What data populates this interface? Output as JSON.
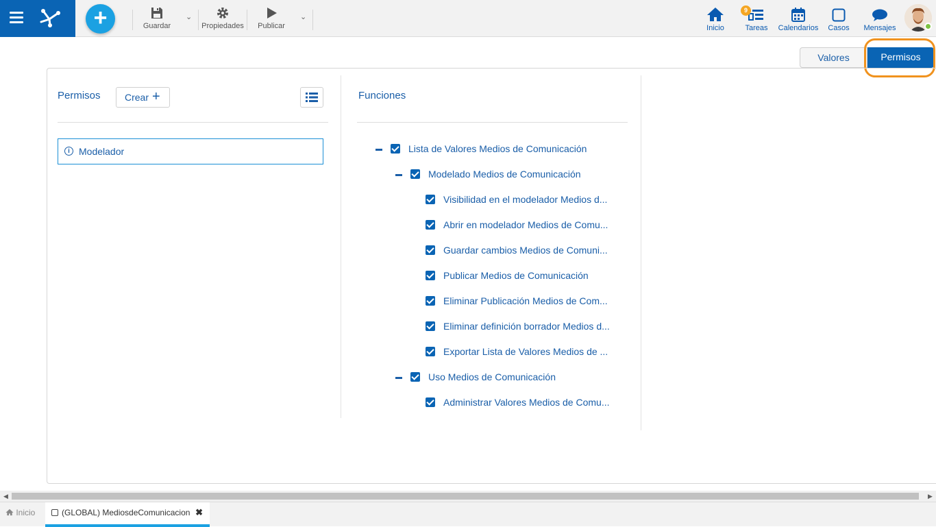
{
  "toolbar": {
    "guardar": "Guardar",
    "propiedades": "Propiedades",
    "publicar": "Publicar"
  },
  "nav": {
    "inicio": "Inicio",
    "tareas": "Tareas",
    "tareas_badge": "9",
    "calendarios": "Calendarios",
    "casos": "Casos",
    "mensajes": "Mensajes"
  },
  "mode_tabs": {
    "valores": "Valores",
    "permisos": "Permisos"
  },
  "permisos_panel": {
    "title": "Permisos",
    "crear_label": "Crear",
    "items": [
      "Modelador"
    ]
  },
  "funciones_panel": {
    "title": "Funciones",
    "tree": [
      "Lista de Valores Medios de Comunicación",
      "Modelado Medios de Comunicación",
      "Visibilidad en el modelador Medios d...",
      "Abrir en modelador Medios de Comu...",
      "Guardar cambios Medios de Comuni...",
      "Publicar Medios de Comunicación",
      "Eliminar Publicación Medios de Com...",
      "Eliminar definición borrador Medios d...",
      "Exportar Lista de Valores Medios de ...",
      "Uso Medios de Comunicación",
      "Administrar Valores Medios de Comu..."
    ]
  },
  "bottom_tabs": {
    "home": "Inicio",
    "active": "(GLOBAL) MediosdeComunicacion"
  },
  "colors": {
    "brand": "#0a64b4",
    "accent": "#1ba1e2",
    "highlight": "#f0921e",
    "text_blue": "#1a5ea8"
  }
}
